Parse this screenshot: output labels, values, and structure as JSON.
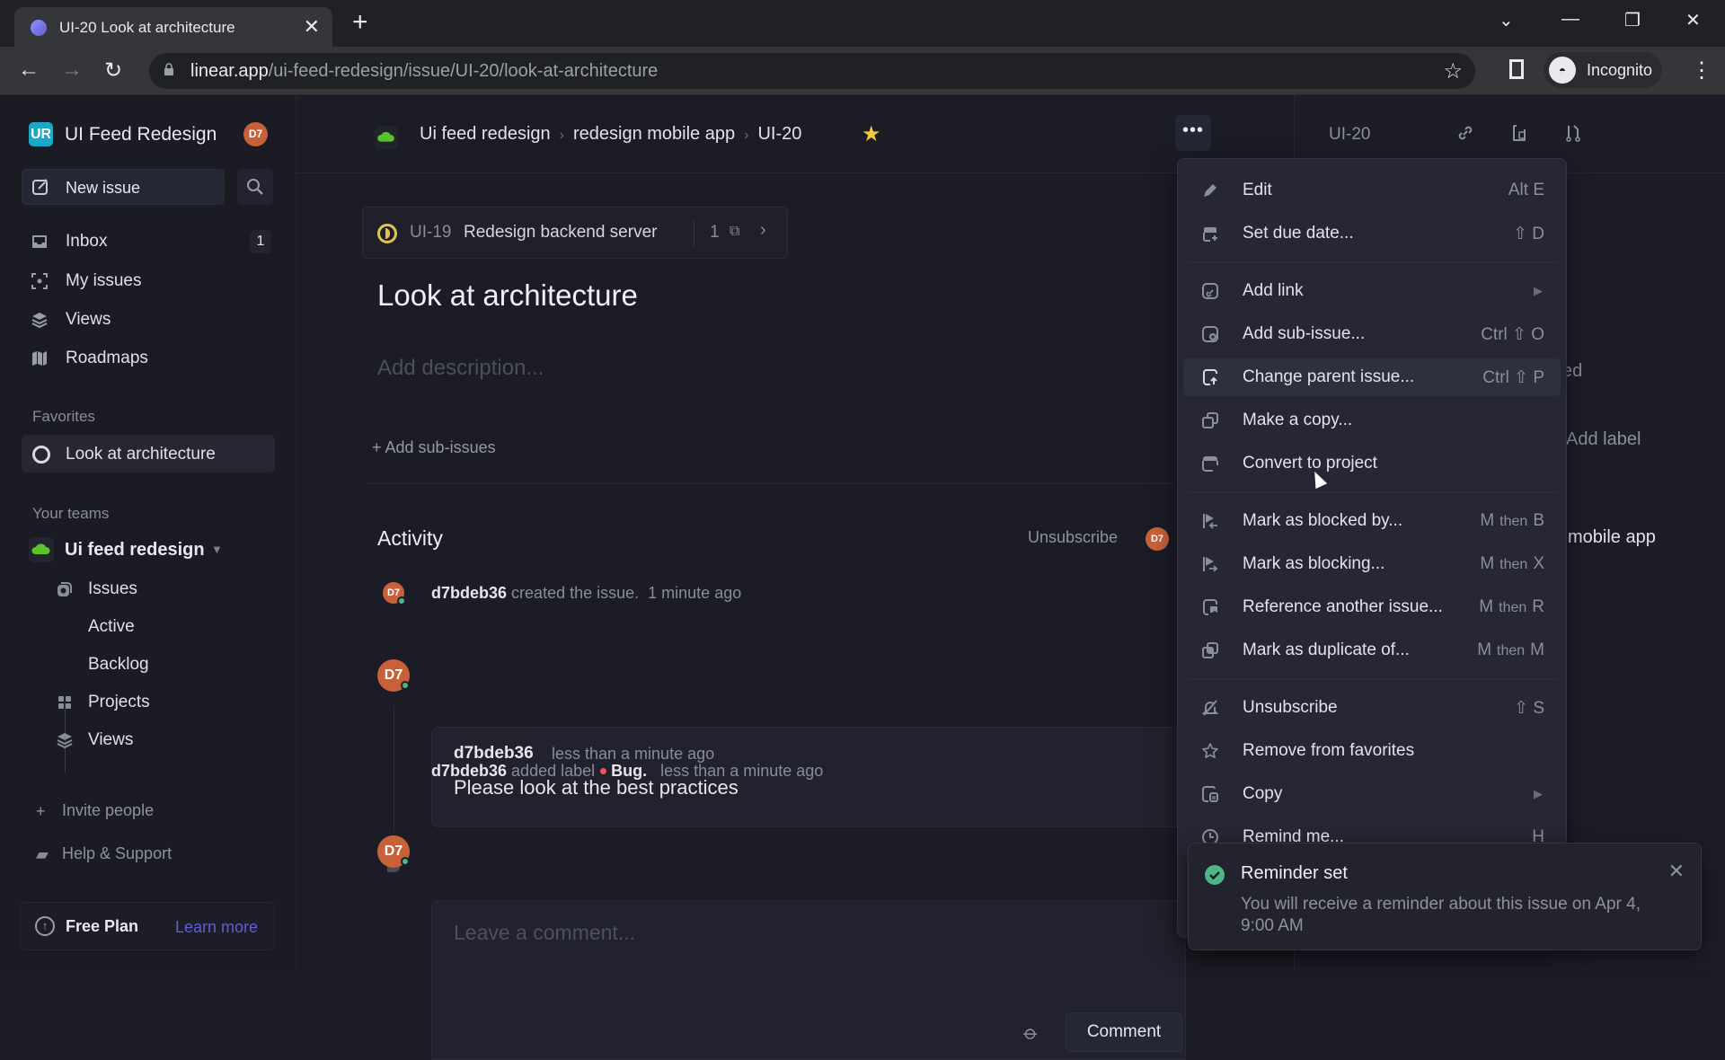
{
  "browser": {
    "tab_title": "UI-20 Look at architecture",
    "url_host": "linear.app",
    "url_path": "/ui-feed-redesign/issue/UI-20/look-at-architecture",
    "profile_label": "Incognito"
  },
  "sidebar": {
    "workspace_initials": "UR",
    "workspace_name": "UI Feed Redesign",
    "user_initials": "D7",
    "new_issue_label": "New issue",
    "nav": [
      {
        "label": "Inbox",
        "icon": "inbox-icon",
        "badge": "1"
      },
      {
        "label": "My issues",
        "icon": "my-issues-icon"
      },
      {
        "label": "Views",
        "icon": "views-icon"
      },
      {
        "label": "Roadmaps",
        "icon": "roadmap-icon"
      }
    ],
    "favorites_label": "Favorites",
    "favorites": [
      {
        "label": "Look at architecture"
      }
    ],
    "teams_label": "Your teams",
    "team": {
      "name": "Ui feed redesign",
      "items": [
        {
          "label": "Issues",
          "icon": "issues-icon"
        },
        {
          "label": "Active"
        },
        {
          "label": "Backlog"
        },
        {
          "label": "Projects",
          "icon": "projects-icon"
        },
        {
          "label": "Views",
          "icon": "views-icon"
        }
      ]
    },
    "invite_label": "Invite people",
    "help_label": "Help & Support",
    "plan_label": "Free Plan",
    "learn_more_label": "Learn more"
  },
  "header": {
    "breadcrumb": [
      "Ui feed redesign",
      "redesign mobile app",
      "UI-20"
    ],
    "favorited": true,
    "more_label": "•••"
  },
  "issue": {
    "parent": {
      "id": "UI-19",
      "title": "Redesign backend server",
      "sub_count": "1"
    },
    "title": "Look at architecture",
    "description_placeholder": "Add description...",
    "add_sub_issues_label": "+ Add sub-issues"
  },
  "activity": {
    "title": "Activity",
    "unsubscribe_label": "Unsubscribe",
    "subscriber_initials": "D7",
    "events": [
      {
        "user": "d7bdeb36",
        "action": "created the issue.",
        "time": "1 minute ago"
      },
      {
        "user": "d7bdeb36",
        "time": "less than a minute ago",
        "body": "Please look at the best practices"
      },
      {
        "user": "d7bdeb36",
        "action": "added label",
        "label": "Bug.",
        "time": "less than a minute ago"
      }
    ],
    "comment_placeholder": "Leave a comment...",
    "comment_button": "Comment"
  },
  "right_panel": {
    "issue_id": "UI-20",
    "partial_status": "ed",
    "add_label": "Add label",
    "project_partial": "mobile app"
  },
  "menu": {
    "items": [
      {
        "label": "Edit",
        "icon": "pencil-icon",
        "shortcut": "Alt  E"
      },
      {
        "label": "Set due date...",
        "icon": "calendar-plus-icon",
        "shortcut": "⇧  D"
      },
      {
        "label": "Add link",
        "icon": "link-icon",
        "submenu": true
      },
      {
        "label": "Add sub-issue...",
        "icon": "add-sub-issue-icon",
        "shortcut": "Ctrl ⇧ O"
      },
      {
        "label": "Change parent issue...",
        "icon": "change-parent-icon",
        "shortcut": "Ctrl ⇧ P",
        "highlighted": true
      },
      {
        "label": "Make a copy...",
        "icon": "copy-duplicate-icon"
      },
      {
        "label": "Convert to project",
        "icon": "convert-project-icon"
      },
      {
        "label": "Mark as blocked by...",
        "icon": "blocked-flag-icon",
        "shortcut_key1": "M",
        "shortcut_then": "then",
        "shortcut_key2": "B"
      },
      {
        "label": "Mark as blocking...",
        "icon": "blocking-flag-icon",
        "shortcut_key1": "M",
        "shortcut_then": "then",
        "shortcut_key2": "X"
      },
      {
        "label": "Reference another issue...",
        "icon": "reference-icon",
        "shortcut_key1": "M",
        "shortcut_then": "then",
        "shortcut_key2": "R"
      },
      {
        "label": "Mark as duplicate of...",
        "icon": "duplicate-icon",
        "shortcut_key1": "M",
        "shortcut_then": "then",
        "shortcut_key2": "M"
      },
      {
        "label": "Unsubscribe",
        "icon": "bell-off-icon",
        "shortcut": "⇧  S"
      },
      {
        "label": "Remove from favorites",
        "icon": "star-outline-icon"
      },
      {
        "label": "Copy",
        "icon": "clipboard-icon",
        "submenu": true
      },
      {
        "label": "Remind me...",
        "icon": "clock-icon",
        "shortcut": "H"
      }
    ]
  },
  "toast": {
    "title": "Reminder set",
    "message": "You will receive a reminder about this issue on Apr 4, 9:00 AM"
  },
  "colors": {
    "accent": "#5e5fcf",
    "avatar": "#c8613a",
    "success": "#4cb782",
    "favorite_star": "#f3c744",
    "label_bug": "#eb5757",
    "team_cloud": "#5cc22c",
    "parent_status": "#e2c44b"
  }
}
